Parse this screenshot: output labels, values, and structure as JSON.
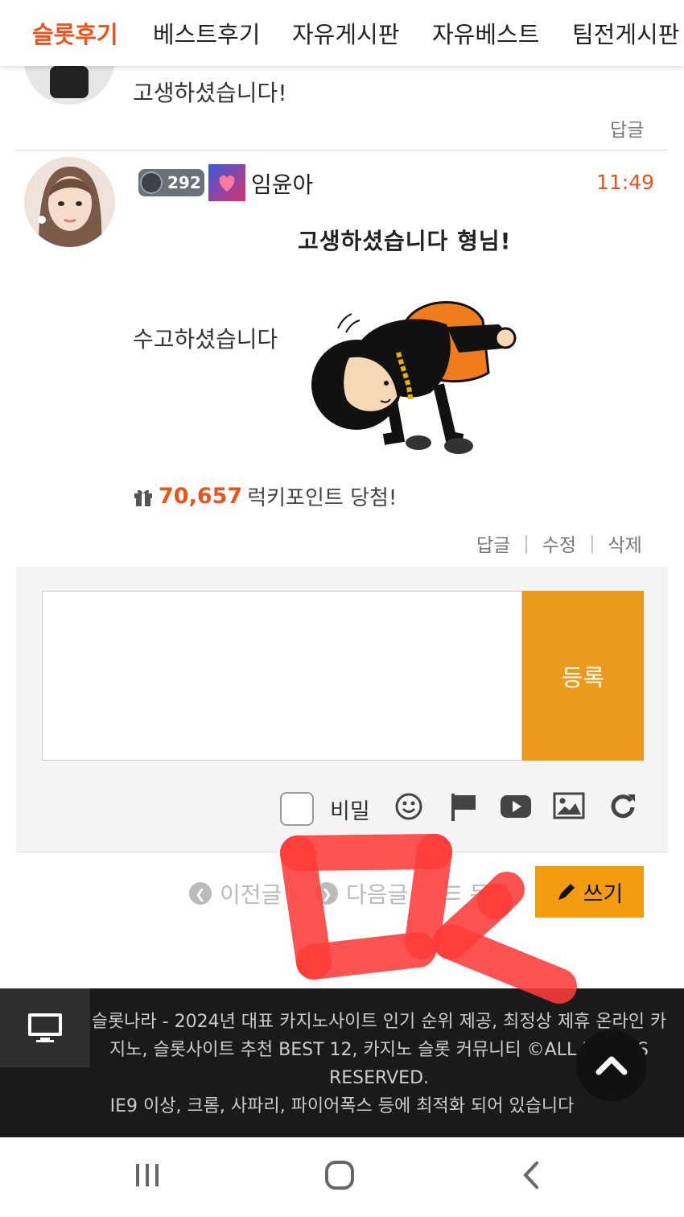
{
  "nav": {
    "tabs": [
      {
        "label": "슬롯후기",
        "active": true
      },
      {
        "label": "베스트후기"
      },
      {
        "label": "자유게시판"
      },
      {
        "label": "자유베스트"
      },
      {
        "label": "팀전게시판"
      }
    ]
  },
  "comment_prev": {
    "text": "고생하셨습니다!",
    "reply_label": "답글"
  },
  "comment_main": {
    "level": "292",
    "author": "임윤아",
    "time": "11:49",
    "emoticon_caption": "고생하셨습니다 형님!",
    "text": "수고하셨습니다",
    "points_value": "70,657",
    "points_text": "럭키포인트 당첨!",
    "actions": [
      "답글",
      "수정",
      "삭제"
    ]
  },
  "comment_form": {
    "submit_label": "등록",
    "secret_label": "비밀",
    "tool_icons": [
      "smile-icon",
      "flag-icon",
      "youtube-icon",
      "image-icon",
      "refresh-icon"
    ]
  },
  "post_nav": {
    "prev_label": "이전글",
    "next_label": "다음글",
    "list_label": "목록",
    "write_label": "쓰기"
  },
  "footer": {
    "line1": "슬롯나라 - 2024년 대표 카지노사이트 인기 순위 제공, 최정상 제휴 온라인 카",
    "line2": "지노, 슬롯사이트 추천 BEST 12, 카지노 슬롯 커뮤니티 ©ALL RIGHTS",
    "line3": "RESERVED.",
    "line4": "IE9 이상, 크롬, 사파리, 파이어폭스 등에 최적화 되어 있습니다"
  },
  "colors": {
    "accent": "#e8541e",
    "submit": "#ec9a1c",
    "write": "#f39c12",
    "annotation": "#ff3b3b"
  }
}
